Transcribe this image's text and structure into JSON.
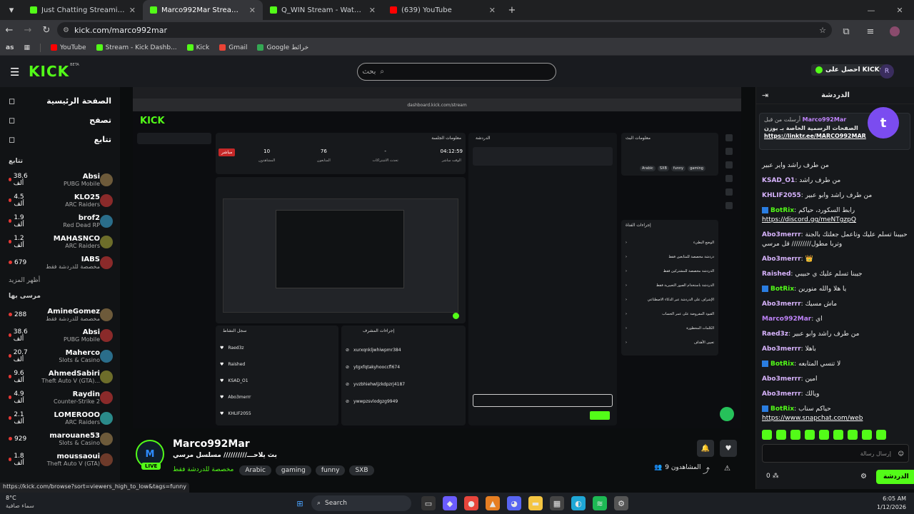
{
  "browser": {
    "tabs": [
      {
        "label": "Just Chatting Streaming - Live S",
        "favicon_color": "#53fc18",
        "active": false
      },
      {
        "label": "Marco992Mar Stream - Wa",
        "favicon_color": "#53fc18",
        "active": true
      },
      {
        "label": "Q_WIN Stream - Watch Live on",
        "favicon_color": "#53fc18",
        "active": false
      },
      {
        "label": "(639) YouTube",
        "favicon_color": "#ff0000",
        "active": false
      }
    ],
    "url": "kick.com/marco992mar",
    "bookmarks": [
      {
        "label": "YouTube",
        "color": "#ff0000"
      },
      {
        "label": "Stream - Kick Dashb...",
        "color": "#53fc18"
      },
      {
        "label": "Kick",
        "color": "#53fc18"
      },
      {
        "label": "Gmail",
        "color": "#ea4335"
      },
      {
        "label": "Google خرائط",
        "color": "#34a853"
      }
    ],
    "profile_initials": "as",
    "status_url": "https://kick.com/browse?sort=viewers_high_to_low&tags=funny"
  },
  "header": {
    "logo": "KICK",
    "logo_badge": "BETA",
    "search_placeholder": "بحث",
    "get_kicks_label": "احصل على KICKs",
    "avatar_initial": "R"
  },
  "sidebar": {
    "nav": [
      {
        "label": "الصفحة الرئيسية",
        "icon": "home-icon"
      },
      {
        "label": "تصفح",
        "icon": "browse-icon"
      },
      {
        "label": "تتابع",
        "icon": "heart-icon"
      }
    ],
    "following_title": "تتابع",
    "following": [
      {
        "name": "Absi",
        "category": "PUBG Mobile",
        "viewers": "38.6 ألف"
      },
      {
        "name": "KLO25",
        "category": "ARC Raiders",
        "viewers": "4.5 ألف"
      },
      {
        "name": "brof2",
        "category": "Red Dead RP",
        "viewers": "1.9 ألف"
      },
      {
        "name": "MAHASNCO",
        "category": "ARC Raiders",
        "viewers": "1.2 ألف"
      },
      {
        "name": "IABS",
        "category": "مخصصة للدردشة فقط",
        "viewers": "679"
      }
    ],
    "show_more": "أظهر المزيد",
    "recommended_title": "مرسى بها",
    "recommended": [
      {
        "name": "AmineGomez",
        "category": "مخصصة للدردشة فقط",
        "viewers": "288"
      },
      {
        "name": "Absi",
        "category": "PUBG Mobile",
        "viewers": "38.6 ألف"
      },
      {
        "name": "Maherco",
        "category": "Slots & Casino",
        "viewers": "20.7 ألف"
      },
      {
        "name": "AhmedSabiri",
        "category": "Theft Auto V (GTA)...",
        "viewers": "9.6 ألف"
      },
      {
        "name": "Raydin",
        "category": "Counter-Strike 2",
        "viewers": "4.9 ألف"
      },
      {
        "name": "LOMEROOO",
        "category": "ARC Raiders",
        "viewers": "2.1 ألف"
      },
      {
        "name": "marouane53",
        "category": "Slots & Casino",
        "viewers": "929"
      },
      {
        "name": "moussaoui",
        "category": "Theft Auto V (GTA)",
        "viewers": "1.8 ألف"
      }
    ]
  },
  "stream": {
    "channel": "Marco992Mar",
    "live_label": "LIVE",
    "title": "بث يلاحـــ////////// مسلسل مرسي",
    "category": "مخصصة للدردشة فقط",
    "tags": [
      "Arabic",
      "gaming",
      "funny",
      "SXB"
    ],
    "viewers_label": "9 المشاهدون"
  },
  "video_overlay": {
    "dashboard_url": "dashboard.kick.com/stream",
    "session_title": "معلومات الجلسة",
    "stats": [
      {
        "value": "04:12:59",
        "label": "الوقت مباشر"
      },
      {
        "value": "-",
        "label": "تحدث الاشتراكات"
      },
      {
        "value": "76",
        "label": "المتابعون"
      },
      {
        "value": "10",
        "label": "المشاهدون"
      }
    ],
    "live_badge": "مباشر",
    "chat_title": "الدردشة",
    "stream_info_title": "معلومات البث",
    "mod_actions_title": "إجراءات المشرف",
    "recent_title": "سجل النشاط",
    "stream_info_tags": [
      "Arabic",
      "SXB",
      "funny",
      "gaming"
    ],
    "quick_actions_title": "إجراءات الفناة",
    "quick_actions": [
      "الوضع البطيء",
      "دردشة مخصصة للمتابعين فقط",
      "الدردشة مخصصة للمشتركين فقط",
      "الدردشة باستخدام الصور التعبيرية فقط",
      "الإشراف على الدردشة عبر الذكاء الاصطناعي",
      "القيود المفروضة على عمر الحساب",
      "الكلمات المحظورة",
      "تعيين الأهداف"
    ],
    "activity_items": [
      "Raed3z",
      "Raished",
      "KSAD_O1",
      "Abo3merrr",
      "KHLIF2055"
    ],
    "mod_items": [
      "xurxqnkljwhiwpmr384",
      "ytgxfqtakyhooccfl674",
      "yvzbhiehwljzkdpzrj4187",
      "ywwpzsvlodgzg9949"
    ]
  },
  "chat": {
    "title": "الدردشة",
    "pinned": {
      "user": "Marco992Mar",
      "sent_by": "أرسلت من قبل",
      "text": "الصفحات الرسمية الخاصة بـ يوزن",
      "link": "https://linktr.ee/MARCO992MAR"
    },
    "messages": [
      {
        "user": "",
        "text": "من طرف راشد واير عبير",
        "color": "#fff",
        "bot": false
      },
      {
        "user": "KSAD_O1",
        "text": "من طرف راشد",
        "color": "#d8b4fe",
        "bot": false
      },
      {
        "user": "KHLIF2055",
        "text": "من طرف راشد وابو عبير",
        "color": "#d8b4fe",
        "bot": false
      },
      {
        "user": "BotRix",
        "text": "رابط السكورد، حياكم",
        "link": "https://discord.gg/meNTgzpQ",
        "color": "#53fc18",
        "bot": true
      },
      {
        "user": "Abo3merrr",
        "text": "حبيبنا تسلم عليك وتاعمل جعلتك بالجنة وتربا مطول///////// قل مرسي",
        "color": "#d8b4fe",
        "bot": false
      },
      {
        "user": "Abo3merrr",
        "text": "👑",
        "color": "#d8b4fe",
        "bot": false
      },
      {
        "user": "Raished",
        "text": "جيبنا تسلم عليك ي حبيبي",
        "color": "#d8b4fe",
        "bot": false
      },
      {
        "user": "BotRix",
        "text": "يا هلا والله منورين",
        "color": "#53fc18",
        "bot": true
      },
      {
        "user": "Abo3merrr",
        "text": "ماش مسيك",
        "color": "#d8b4fe",
        "bot": false
      },
      {
        "user": "Marco992Mar",
        "text": "اي",
        "color": "#c084fc",
        "bot": false
      },
      {
        "user": "Raed3z",
        "text": "من طرف راشد وابو عبير",
        "color": "#d8b4fe",
        "bot": false
      },
      {
        "user": "Abo3merrr",
        "text": "باهلا",
        "color": "#d8b4fe",
        "bot": false
      },
      {
        "user": "BotRix",
        "text": "لا تنسي المتابعه",
        "color": "#53fc18",
        "bot": true
      },
      {
        "user": "Abo3merrr",
        "text": "امين",
        "color": "#d8b4fe",
        "bot": false
      },
      {
        "user": "Abo3merrr",
        "text": "ويالك",
        "color": "#d8b4fe",
        "bot": false
      },
      {
        "user": "BotRix",
        "text": "حياكم سناب",
        "link": "https://www.snapchat.com/web",
        "color": "#53fc18",
        "bot": true
      }
    ],
    "input_placeholder": "إرسال رسالة",
    "send_label": "الدردشة",
    "kicks_count": "0"
  },
  "taskbar": {
    "weather_temp": "8°C",
    "weather_desc": "سماء صافية",
    "search_label": "Search",
    "time": "6:05 AM",
    "date": "1/12/2026"
  }
}
